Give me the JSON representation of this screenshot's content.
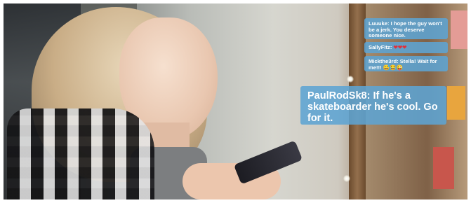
{
  "comments": [
    {
      "user": "Luuuke",
      "text": "I hope the guy won't be a jerk. You deserve someone nice."
    },
    {
      "user": "SallyFitz",
      "text": "❤❤❤"
    },
    {
      "user": "Mickthe3rd",
      "text": "Stella! Wait for me!!! 😅😂😜"
    }
  ],
  "featured_comment": {
    "user": "PaulRodSk8",
    "text": "If he's a skateboarder he's cool. Go for it."
  },
  "colors": {
    "bubble": "#5da4d3",
    "bubble_text": "#ffffff",
    "hearts": "#e0303a"
  }
}
